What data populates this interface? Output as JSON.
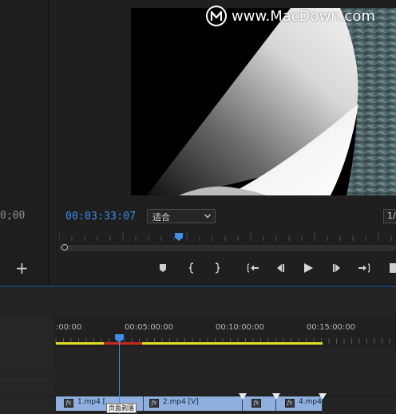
{
  "watermark": {
    "text": "www.MacDown.com"
  },
  "left_panel": {
    "timecode": "0;00",
    "add_icon": "plus-icon"
  },
  "program_monitor": {
    "timecode": "00:03:33:07",
    "fit": {
      "label": "适合",
      "icon": "chevron-down-icon"
    },
    "resolution": {
      "label": "1/"
    },
    "controls": [
      {
        "icon": "add-marker-icon"
      },
      {
        "icon": "mark-in-icon"
      },
      {
        "icon": "mark-out-icon"
      },
      {
        "icon": "go-to-in-icon"
      },
      {
        "icon": "step-back-icon"
      },
      {
        "icon": "play-icon"
      },
      {
        "icon": "step-forward-icon"
      },
      {
        "icon": "go-to-out-icon"
      }
    ]
  },
  "timeline": {
    "ruler_labels": [
      ":00:00",
      "00:05:00:00",
      "00:10:00:00",
      "00:15:00:00"
    ],
    "clips": [
      {
        "name": "1.mp4 [",
        "fx": "fx"
      },
      {
        "name": "2.mp4 [V]",
        "fx": "fx"
      },
      {
        "name": "",
        "fx": "fx"
      },
      {
        "name": "4.mp4",
        "fx": "fx"
      }
    ],
    "tooltip": "页面剥落"
  },
  "colors": {
    "accent": "#3c8ee8",
    "work_area": "#e0e022",
    "clip": "#8fb0de",
    "render_red": "#c8291f"
  }
}
